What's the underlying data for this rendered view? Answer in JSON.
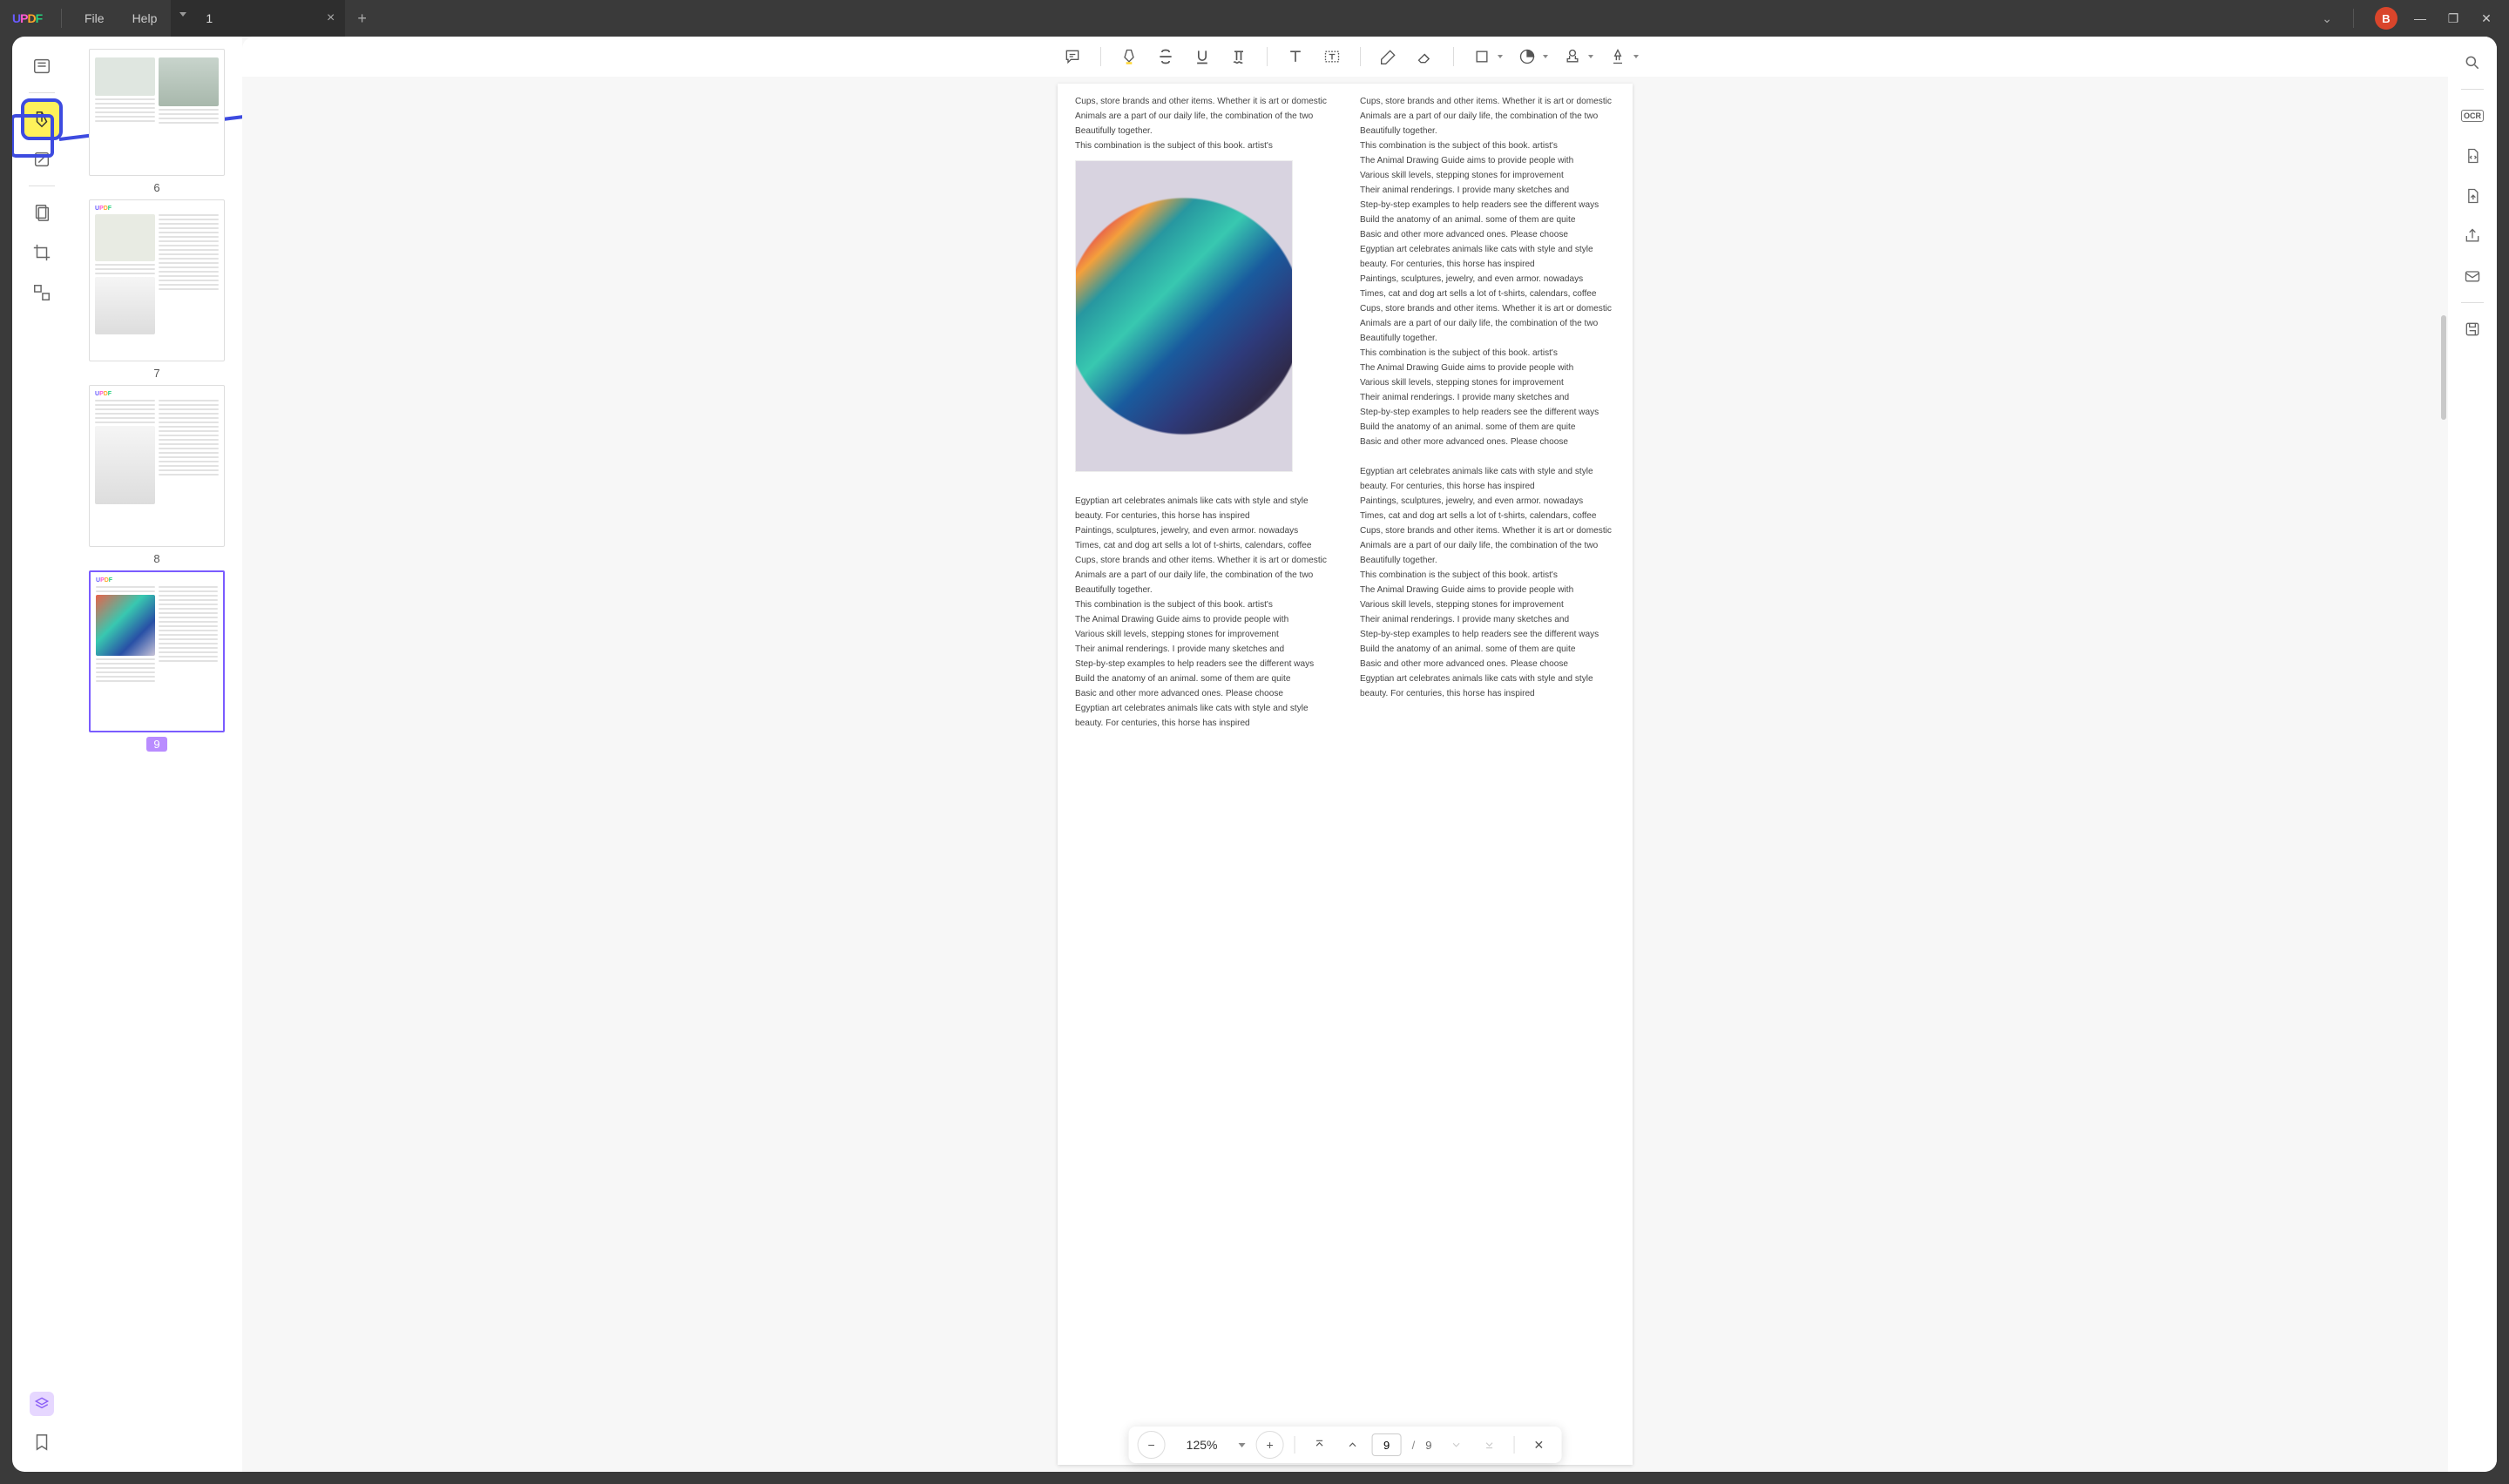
{
  "app": {
    "logo": [
      "U",
      "P",
      "D",
      "F"
    ]
  },
  "menu": {
    "file": "File",
    "help": "Help"
  },
  "tab": {
    "title": "1"
  },
  "avatar": "B",
  "thumbnails": [
    {
      "num": "6"
    },
    {
      "num": "7"
    },
    {
      "num": "8"
    },
    {
      "num": "9"
    }
  ],
  "doc": {
    "lines": [
      "Cups, store brands and other items. Whether it is art or domestic",
      "Animals are a part of our daily life, the combination of the two",
      "Beautifully together.",
      "This combination is the subject of this book. artist's",
      "The Animal Drawing Guide aims to provide people with",
      "Various skill levels, stepping stones for improvement",
      "Their animal renderings. I provide many sketches and",
      "Step-by-step examples to help readers see the different ways",
      "Build the anatomy of an animal. some of them are quite",
      "Basic and other more advanced ones. Please choose",
      "Egyptian art celebrates animals like cats with style and style",
      "beauty. For centuries, this horse has inspired",
      "Paintings, sculptures, jewelry, and even armor. nowadays",
      "Times, cat and dog art sells a lot of t-shirts, calendars, coffee"
    ],
    "left_top": [
      0,
      1,
      2,
      3
    ],
    "right_block": [
      0,
      1,
      2,
      3,
      4,
      5,
      6,
      7,
      8,
      9,
      10,
      11,
      12,
      13,
      0,
      1,
      2,
      3,
      4,
      5,
      6,
      7,
      8,
      9
    ],
    "lower_block": [
      10,
      11,
      12,
      13,
      0,
      1,
      2,
      3,
      4,
      5,
      6,
      7,
      8,
      9,
      10,
      11
    ]
  },
  "nav": {
    "zoom": "125%",
    "page": "9",
    "sep": "/",
    "total": "9"
  }
}
